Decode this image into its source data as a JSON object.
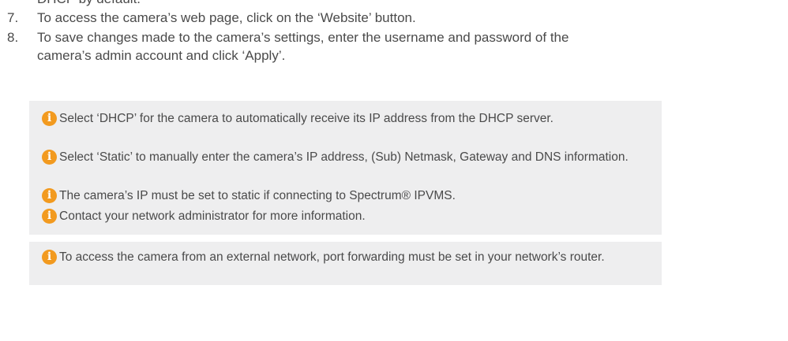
{
  "steps": {
    "cutoff_line": "DHCP by default.",
    "items": [
      {
        "number": "7.",
        "text": "To access the camera’s web page, click on the ‘Website’ button."
      },
      {
        "number": "8.",
        "text": "To save changes made to the camera’s settings, enter the username and password of the",
        "continuation": "camera’s admin account and click ‘Apply’."
      }
    ]
  },
  "notes": {
    "icon": "info-icon",
    "icon_glyph": "i",
    "icon_color": "#f29a1f",
    "box_color": "#eeeeef",
    "group_1": [
      "Select ‘DHCP’ for the camera to automatically receive its IP address from the DHCP server.",
      "Select ‘Static’ to manually enter the camera’s IP address, (Sub) Netmask, Gateway and DNS information.",
      "The camera’s IP must be set to static if connecting to Spectrum® IPVMS.",
      "Contact your network administrator for more information."
    ],
    "group_2": [
      "To access the camera from an external network, port forwarding must be set in your network’s router."
    ]
  }
}
